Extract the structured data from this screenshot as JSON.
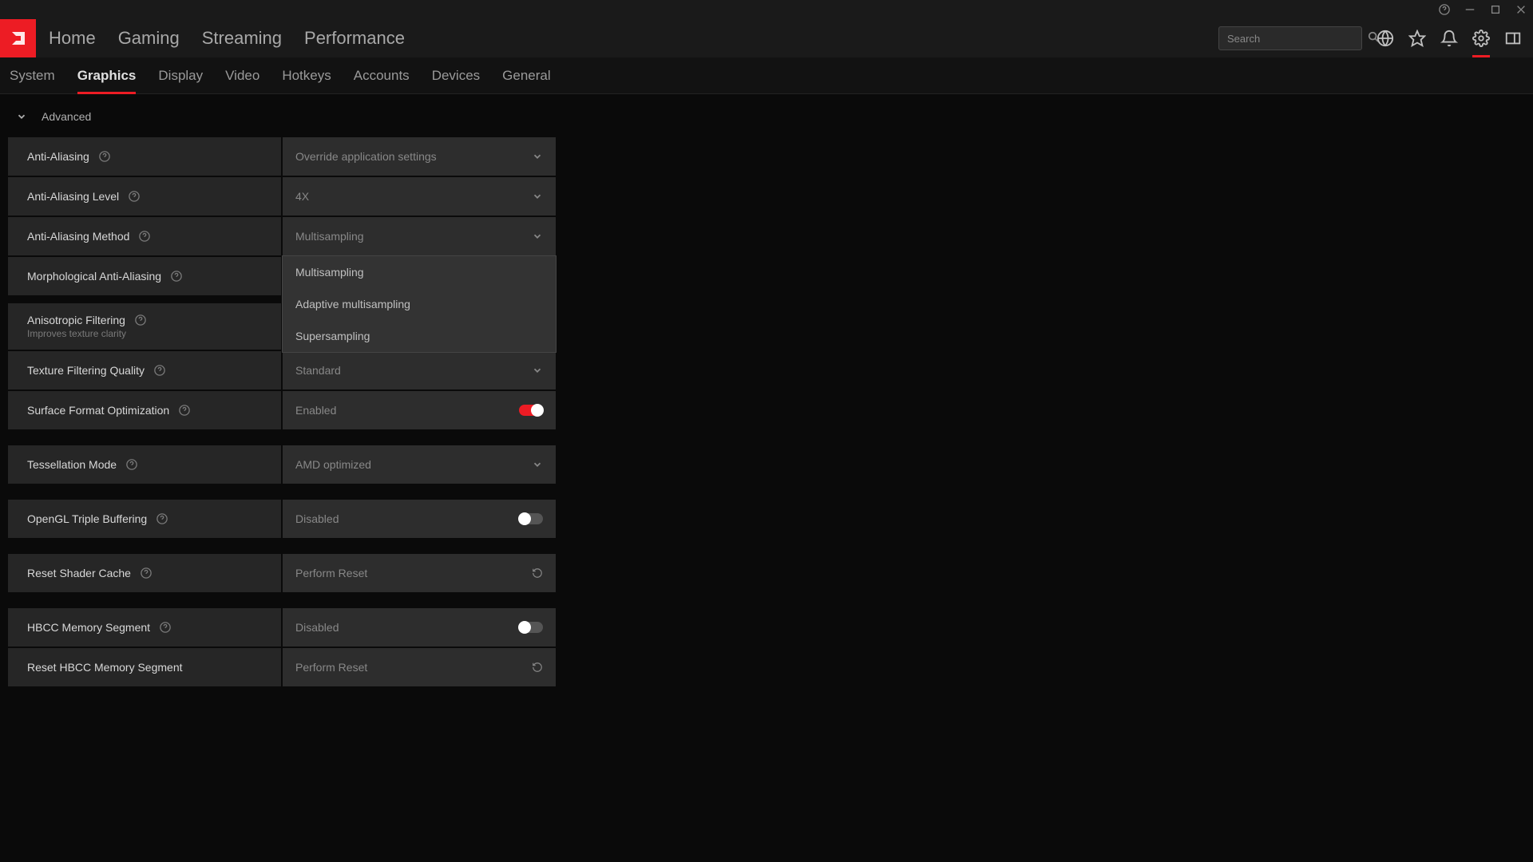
{
  "titlebar": {
    "help": "?",
    "min": "−",
    "max": "□",
    "close": "✕"
  },
  "topnav": {
    "items": [
      "Home",
      "Gaming",
      "Streaming",
      "Performance"
    ],
    "search_placeholder": "Search"
  },
  "subnav": {
    "items": [
      "System",
      "Graphics",
      "Display",
      "Video",
      "Hotkeys",
      "Accounts",
      "Devices",
      "General"
    ],
    "active": "Graphics"
  },
  "section": {
    "title": "Advanced"
  },
  "settings": {
    "anti_aliasing": {
      "label": "Anti-Aliasing",
      "value": "Override application settings"
    },
    "aa_level": {
      "label": "Anti-Aliasing Level",
      "value": "4X"
    },
    "aa_method": {
      "label": "Anti-Aliasing Method",
      "value": "Multisampling",
      "options": [
        "Multisampling",
        "Adaptive multisampling",
        "Supersampling"
      ]
    },
    "morph_aa": {
      "label": "Morphological Anti-Aliasing"
    },
    "aniso": {
      "label": "Anisotropic Filtering",
      "sub": "Improves texture clarity"
    },
    "tex_filter": {
      "label": "Texture Filtering Quality",
      "value": "Standard"
    },
    "surf_opt": {
      "label": "Surface Format Optimization",
      "value": "Enabled"
    },
    "tess": {
      "label": "Tessellation Mode",
      "value": "AMD optimized"
    },
    "ogl_triple": {
      "label": "OpenGL Triple Buffering",
      "value": "Disabled"
    },
    "reset_shader": {
      "label": "Reset Shader Cache",
      "value": "Perform Reset"
    },
    "hbcc": {
      "label": "HBCC Memory Segment",
      "value": "Disabled"
    },
    "reset_hbcc": {
      "label": "Reset HBCC Memory Segment",
      "value": "Perform Reset"
    }
  }
}
